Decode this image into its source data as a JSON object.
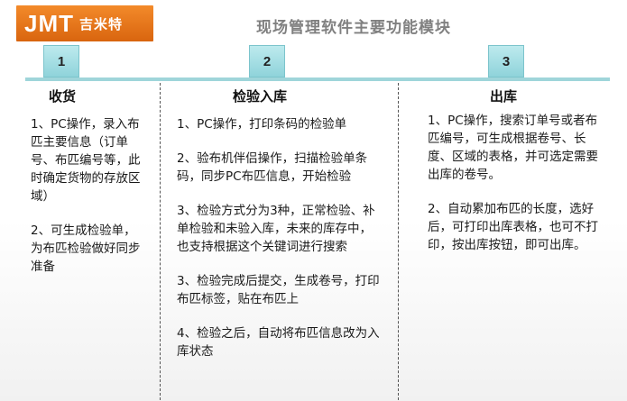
{
  "logo": {
    "en": "JMT",
    "cn": "吉米特"
  },
  "page_title": "现场管理软件主要功能模块",
  "columns": [
    {
      "number": "1",
      "title": "收货",
      "paragraphs": [
        "1、PC操作，录入布匹主要信息（订单号、布匹编号等，此时确定货物的存放区域）",
        "2、可生成检验单，为布匹检验做好同步准备"
      ]
    },
    {
      "number": "2",
      "title": "检验入库",
      "paragraphs": [
        "1、PC操作，打印条码的检验单",
        "2、验布机伴侣操作，扫描检验单条码，同步PC布匹信息，开始检验",
        "3、检验方式分为3种，正常检验、补单检验和未验入库，未来的库存中，也支持根据这个关键词进行搜索",
        "3、检验完成后提交，生成卷号，打印布匹标签，贴在布匹上",
        "4、检验之后，自动将布匹信息改为入库状态"
      ]
    },
    {
      "number": "3",
      "title": "出库",
      "paragraphs": [
        "1、PC操作，搜索订单号或者布匹编号，可生成根据卷号、长度、区域的表格，并可选定需要出库的卷号。",
        "2、自动累加布匹的长度，选好后，可打印出库表格，也可不打印，按出库按钮，即可出库。"
      ]
    }
  ]
}
